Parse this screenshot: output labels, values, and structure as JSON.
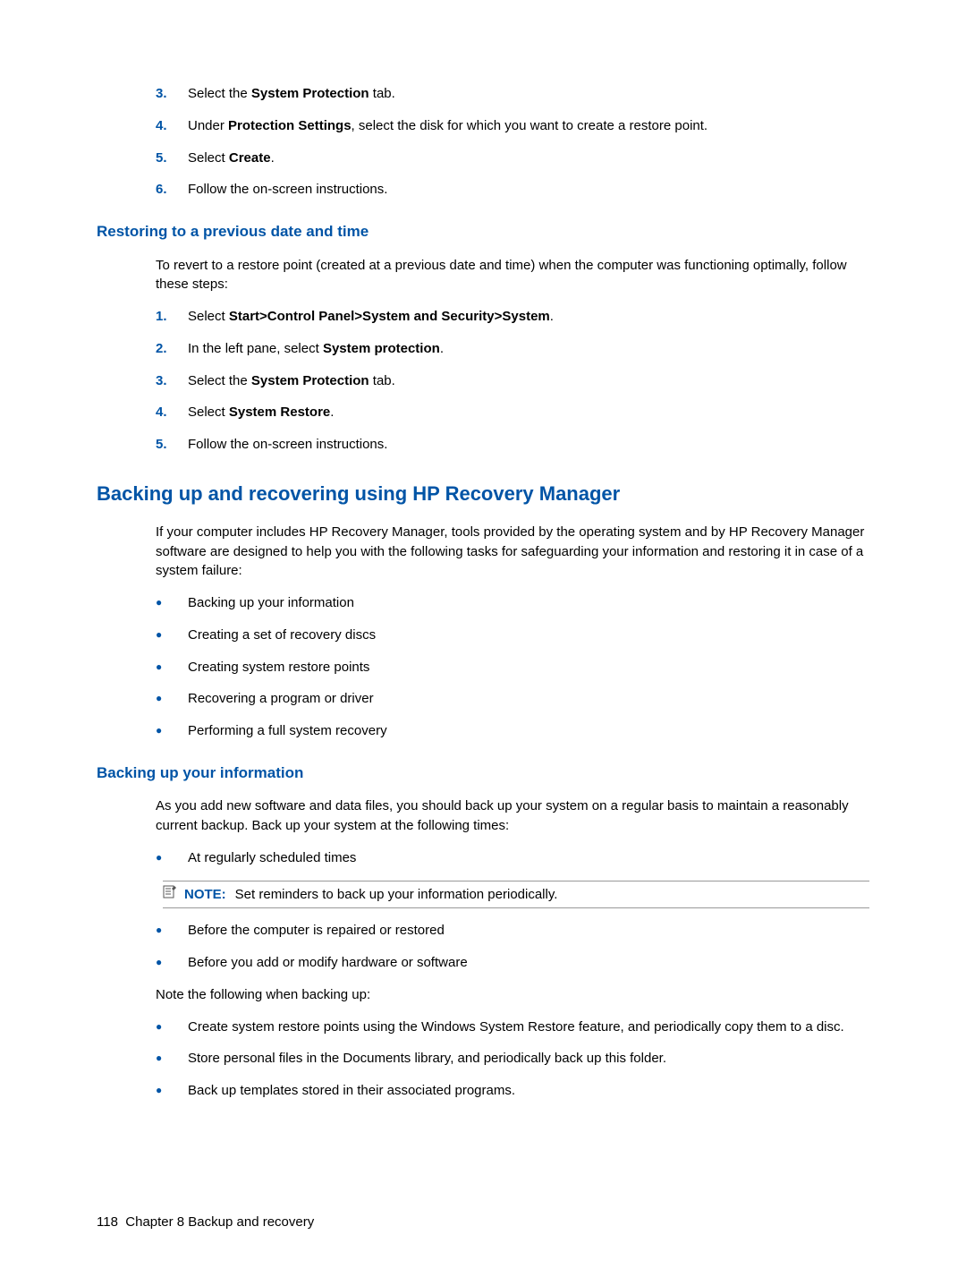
{
  "list1": [
    {
      "n": "3.",
      "segments": [
        {
          "t": "Select the "
        },
        {
          "t": "System Protection",
          "b": true
        },
        {
          "t": " tab."
        }
      ]
    },
    {
      "n": "4.",
      "segments": [
        {
          "t": "Under "
        },
        {
          "t": "Protection Settings",
          "b": true
        },
        {
          "t": ", select the disk for which you want to create a restore point."
        }
      ]
    },
    {
      "n": "5.",
      "segments": [
        {
          "t": "Select "
        },
        {
          "t": "Create",
          "b": true
        },
        {
          "t": "."
        }
      ]
    },
    {
      "n": "6.",
      "segments": [
        {
          "t": "Follow the on-screen instructions."
        }
      ]
    }
  ],
  "h_restore": "Restoring to a previous date and time",
  "p_restore": "To revert to a restore point (created at a previous date and time) when the computer was functioning optimally, follow these steps:",
  "list2": [
    {
      "n": "1.",
      "segments": [
        {
          "t": "Select "
        },
        {
          "t": "Start>Control Panel>System and Security>System",
          "b": true
        },
        {
          "t": "."
        }
      ]
    },
    {
      "n": "2.",
      "segments": [
        {
          "t": "In the left pane, select "
        },
        {
          "t": "System protection",
          "b": true
        },
        {
          "t": "."
        }
      ]
    },
    {
      "n": "3.",
      "segments": [
        {
          "t": "Select the "
        },
        {
          "t": "System Protection",
          "b": true
        },
        {
          "t": " tab."
        }
      ]
    },
    {
      "n": "4.",
      "segments": [
        {
          "t": "Select "
        },
        {
          "t": "System Restore",
          "b": true
        },
        {
          "t": "."
        }
      ]
    },
    {
      "n": "5.",
      "segments": [
        {
          "t": "Follow the on-screen instructions."
        }
      ]
    }
  ],
  "h_backup": "Backing up and recovering using HP Recovery Manager",
  "p_backup": "If your computer includes HP Recovery Manager, tools provided by the operating system and by HP Recovery Manager software are designed to help you with the following tasks for safeguarding your information and restoring it in case of a system failure:",
  "bullets1": [
    "Backing up your information",
    "Creating a set of recovery discs",
    "Creating system restore points",
    "Recovering a program or driver",
    "Performing a full system recovery"
  ],
  "h_info": "Backing up your information",
  "p_info": "As you add new software and data files, you should back up your system on a regular basis to maintain a reasonably current backup. Back up your system at the following times:",
  "bullets2a": [
    "At regularly scheduled times"
  ],
  "note_label": "NOTE:",
  "note_text": "Set reminders to back up your information periodically.",
  "bullets2b": [
    "Before the computer is repaired or restored",
    "Before you add or modify hardware or software"
  ],
  "p_notefollow": "Note the following when backing up:",
  "bullets3": [
    "Create system restore points using the Windows System Restore feature, and periodically copy them to a disc.",
    "Store personal files in the Documents library, and periodically back up this folder.",
    "Back up templates stored in their associated programs."
  ],
  "footer_page": "118",
  "footer_chapter": "Chapter 8   Backup and recovery"
}
